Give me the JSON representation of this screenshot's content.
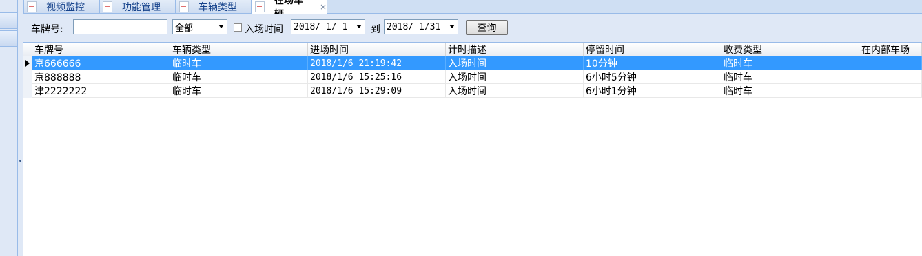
{
  "tabs": [
    {
      "label": "视频监控"
    },
    {
      "label": "功能管理"
    },
    {
      "label": "车辆类型"
    },
    {
      "label": "在场车辆",
      "close": "×"
    }
  ],
  "toolbar": {
    "plate_label": "车牌号:",
    "plate_value": "",
    "type_value": "全部",
    "entry_time_label": "入场时间",
    "entry_time_checked": false,
    "date_from": "2018/ 1/ 1",
    "to_label": "到",
    "date_to": "2018/ 1/31",
    "query_label": "查询"
  },
  "grid": {
    "columns": [
      "车牌号",
      "车辆类型",
      "进场时间",
      "计时描述",
      "停留时间",
      "收费类型",
      "在内部车场"
    ],
    "rows": [
      {
        "plate": "京666666",
        "type": "临时车",
        "entry": "2018/1/6 21:19:42",
        "desc": "入场时间",
        "stay": "10分钟",
        "fee": "临时车",
        "inner": "",
        "selected": true
      },
      {
        "plate": "京888888",
        "type": "临时车",
        "entry": "2018/1/6 15:25:16",
        "desc": "入场时间",
        "stay": "6小时5分钟",
        "fee": "临时车",
        "inner": "",
        "selected": false
      },
      {
        "plate": "津2222222",
        "type": "临时车",
        "entry": "2018/1/6 15:29:09",
        "desc": "入场时间",
        "stay": "6小时1分钟",
        "fee": "临时车",
        "inner": "",
        "selected": false
      }
    ]
  },
  "colors": {
    "selection": "#3399ff",
    "panel": "#dfe8f6",
    "border": "#99bbe8"
  }
}
